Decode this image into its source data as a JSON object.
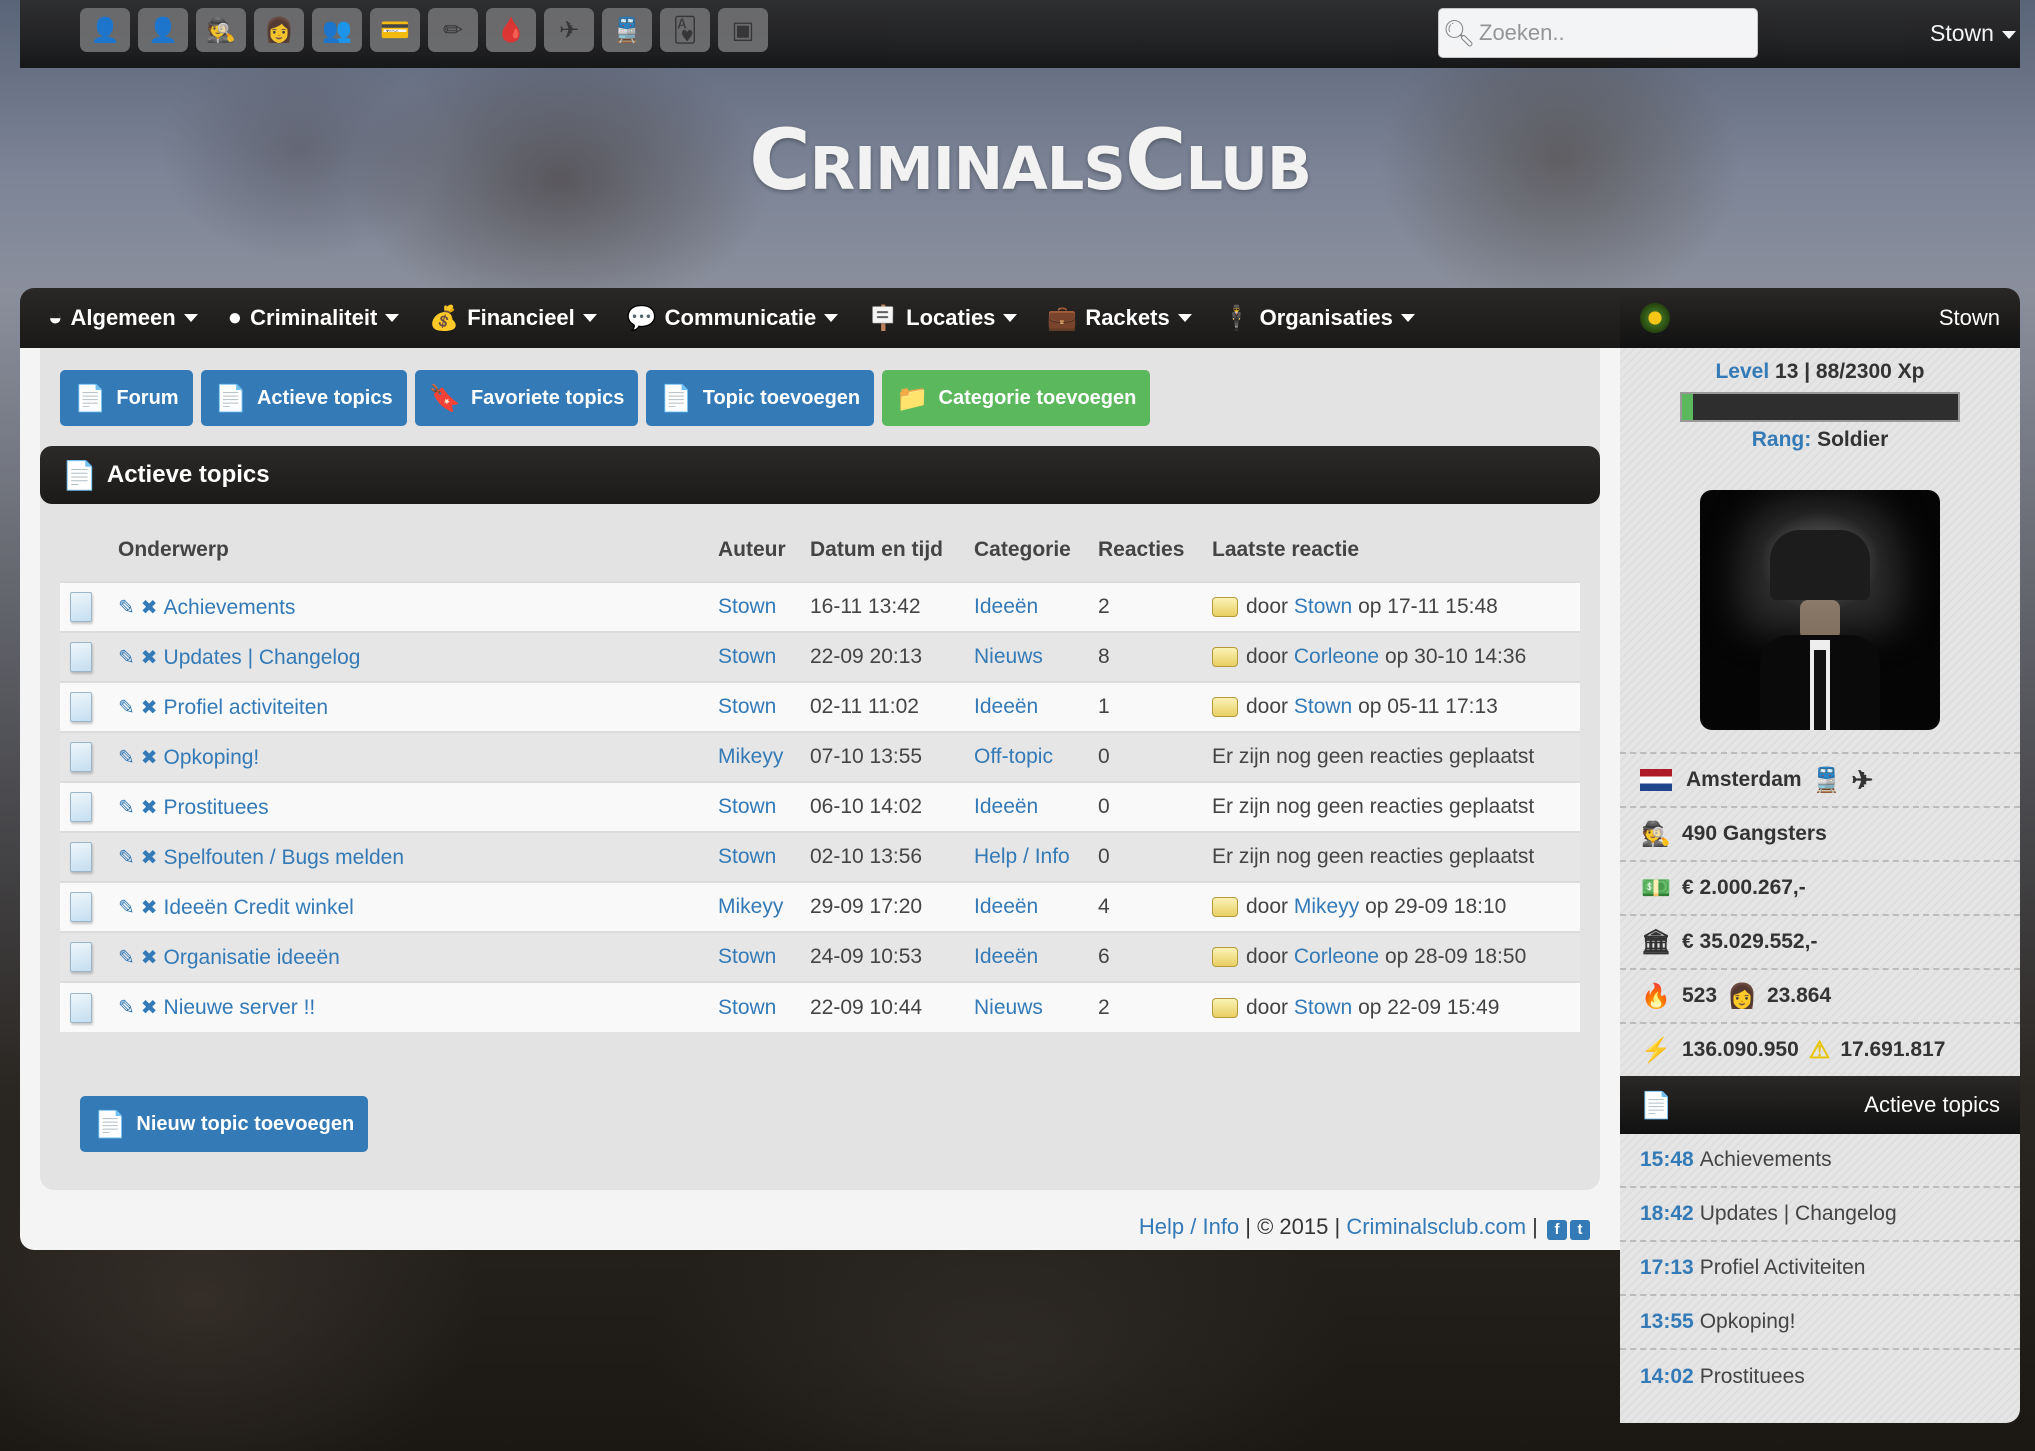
{
  "topbar": {
    "quick_icons": [
      {
        "name": "gangster-icon",
        "glyph": "👤"
      },
      {
        "name": "hooded-figure-icon",
        "glyph": "👤"
      },
      {
        "name": "detective-icon",
        "glyph": "🕵"
      },
      {
        "name": "woman-icon",
        "glyph": "👩"
      },
      {
        "name": "group-icon",
        "glyph": "👥"
      },
      {
        "name": "credit-card-icon",
        "glyph": "💳"
      },
      {
        "name": "bullet-icon",
        "glyph": "✏"
      },
      {
        "name": "blood-bag-icon",
        "glyph": "🩸"
      },
      {
        "name": "airplane-icon",
        "glyph": "✈"
      },
      {
        "name": "train-icon",
        "glyph": "🚆"
      },
      {
        "name": "playing-card-icon",
        "glyph": "🂱"
      },
      {
        "name": "prison-icon",
        "glyph": "▣"
      }
    ],
    "search_placeholder": "Zoeken..",
    "search_value": "",
    "user": "Stown"
  },
  "logo": "CriminalsClub",
  "nav": [
    {
      "label": "Algemeen",
      "icon": "speedometer-icon",
      "glyph": "◒"
    },
    {
      "label": "Criminaliteit",
      "icon": "bomb-icon",
      "glyph": "●"
    },
    {
      "label": "Financieel",
      "icon": "money-bag-icon",
      "glyph": "💰"
    },
    {
      "label": "Communicatie",
      "icon": "chat-icon",
      "glyph": "💬"
    },
    {
      "label": "Locaties",
      "icon": "signpost-icon",
      "glyph": "🪧"
    },
    {
      "label": "Rackets",
      "icon": "briefcase-icon",
      "glyph": "💼"
    },
    {
      "label": "Organisaties",
      "icon": "mobster-icon",
      "glyph": "🕴"
    }
  ],
  "toolbar": {
    "forum": "Forum",
    "active_topics": "Actieve topics",
    "favorite_topics": "Favoriete topics",
    "add_topic": "Topic toevoegen",
    "add_category": "Categorie toevoegen"
  },
  "heading": "Actieve topics",
  "table": {
    "columns": [
      "",
      "Onderwerp",
      "Auteur",
      "Datum en tijd",
      "Categorie",
      "Reacties",
      "Laatste reactie"
    ],
    "rows": [
      {
        "subject": "Achievements",
        "author": "Stown",
        "date": "16-11 13:42",
        "category": "Ideeën",
        "replies": "2",
        "last_prefix": "door",
        "last_user": "Stown",
        "last_suffix": "op 17-11 15:48",
        "no_reply": ""
      },
      {
        "subject": "Updates | Changelog",
        "author": "Stown",
        "date": "22-09 20:13",
        "category": "Nieuws",
        "replies": "8",
        "last_prefix": "door",
        "last_user": "Corleone",
        "last_suffix": "op 30-10 14:36",
        "no_reply": ""
      },
      {
        "subject": "Profiel activiteiten",
        "author": "Stown",
        "date": "02-11 11:02",
        "category": "Ideeën",
        "replies": "1",
        "last_prefix": "door",
        "last_user": "Stown",
        "last_suffix": "op 05-11 17:13",
        "no_reply": ""
      },
      {
        "subject": "Opkoping!",
        "author": "Mikeyy",
        "date": "07-10 13:55",
        "category": "Off-topic",
        "replies": "0",
        "last_prefix": "",
        "last_user": "",
        "last_suffix": "",
        "no_reply": "Er zijn nog geen reacties geplaatst"
      },
      {
        "subject": "Prostituees",
        "author": "Stown",
        "date": "06-10 14:02",
        "category": "Ideeën",
        "replies": "0",
        "last_prefix": "",
        "last_user": "",
        "last_suffix": "",
        "no_reply": "Er zijn nog geen reacties geplaatst"
      },
      {
        "subject": "Spelfouten / Bugs melden",
        "author": "Stown",
        "date": "02-10 13:56",
        "category": "Help / Info",
        "replies": "0",
        "last_prefix": "",
        "last_user": "",
        "last_suffix": "",
        "no_reply": "Er zijn nog geen reacties geplaatst"
      },
      {
        "subject": "Ideeën Credit winkel",
        "author": "Mikeyy",
        "date": "29-09 17:20",
        "category": "Ideeën",
        "replies": "4",
        "last_prefix": "door",
        "last_user": "Mikeyy",
        "last_suffix": "op 29-09 18:10",
        "no_reply": ""
      },
      {
        "subject": "Organisatie ideeën",
        "author": "Stown",
        "date": "24-09 10:53",
        "category": "Ideeën",
        "replies": "6",
        "last_prefix": "door",
        "last_user": "Corleone",
        "last_suffix": "op 28-09 18:50",
        "no_reply": ""
      },
      {
        "subject": "Nieuwe server !!",
        "author": "Stown",
        "date": "22-09 10:44",
        "category": "Nieuws",
        "replies": "2",
        "last_prefix": "door",
        "last_user": "Stown",
        "last_suffix": "op 22-09 15:49",
        "no_reply": ""
      }
    ]
  },
  "new_topic_button": "Nieuw topic toevoegen",
  "footer": {
    "help": "Help / Info",
    "sep1": " | © 2015 | ",
    "site": "Criminalsclub.com",
    "sep2": " | "
  },
  "sidebar": {
    "username": "Stown",
    "level_label": "Level",
    "level_value": "13 | 88/2300 Xp",
    "xp_current": 88,
    "xp_max": 2300,
    "rank_label": "Rang:",
    "rank_value": "Soldier",
    "city": "Amsterdam",
    "gangsters": "490 Gangsters",
    "cash": "€ 2.000.267,-",
    "bank": "€ 35.029.552,-",
    "fire": "523",
    "hoes": "23.864",
    "power": "136.090.950",
    "power_alt": "17.691.817",
    "active_topics_title": "Actieve topics",
    "active_topics": [
      {
        "time": "15:48",
        "title": "Achievements"
      },
      {
        "time": "18:42",
        "title": "Updates | Changelog"
      },
      {
        "time": "17:13",
        "title": "Profiel Activiteiten"
      },
      {
        "time": "13:55",
        "title": "Opkoping!"
      },
      {
        "time": "14:02",
        "title": "Prostituees"
      }
    ]
  }
}
